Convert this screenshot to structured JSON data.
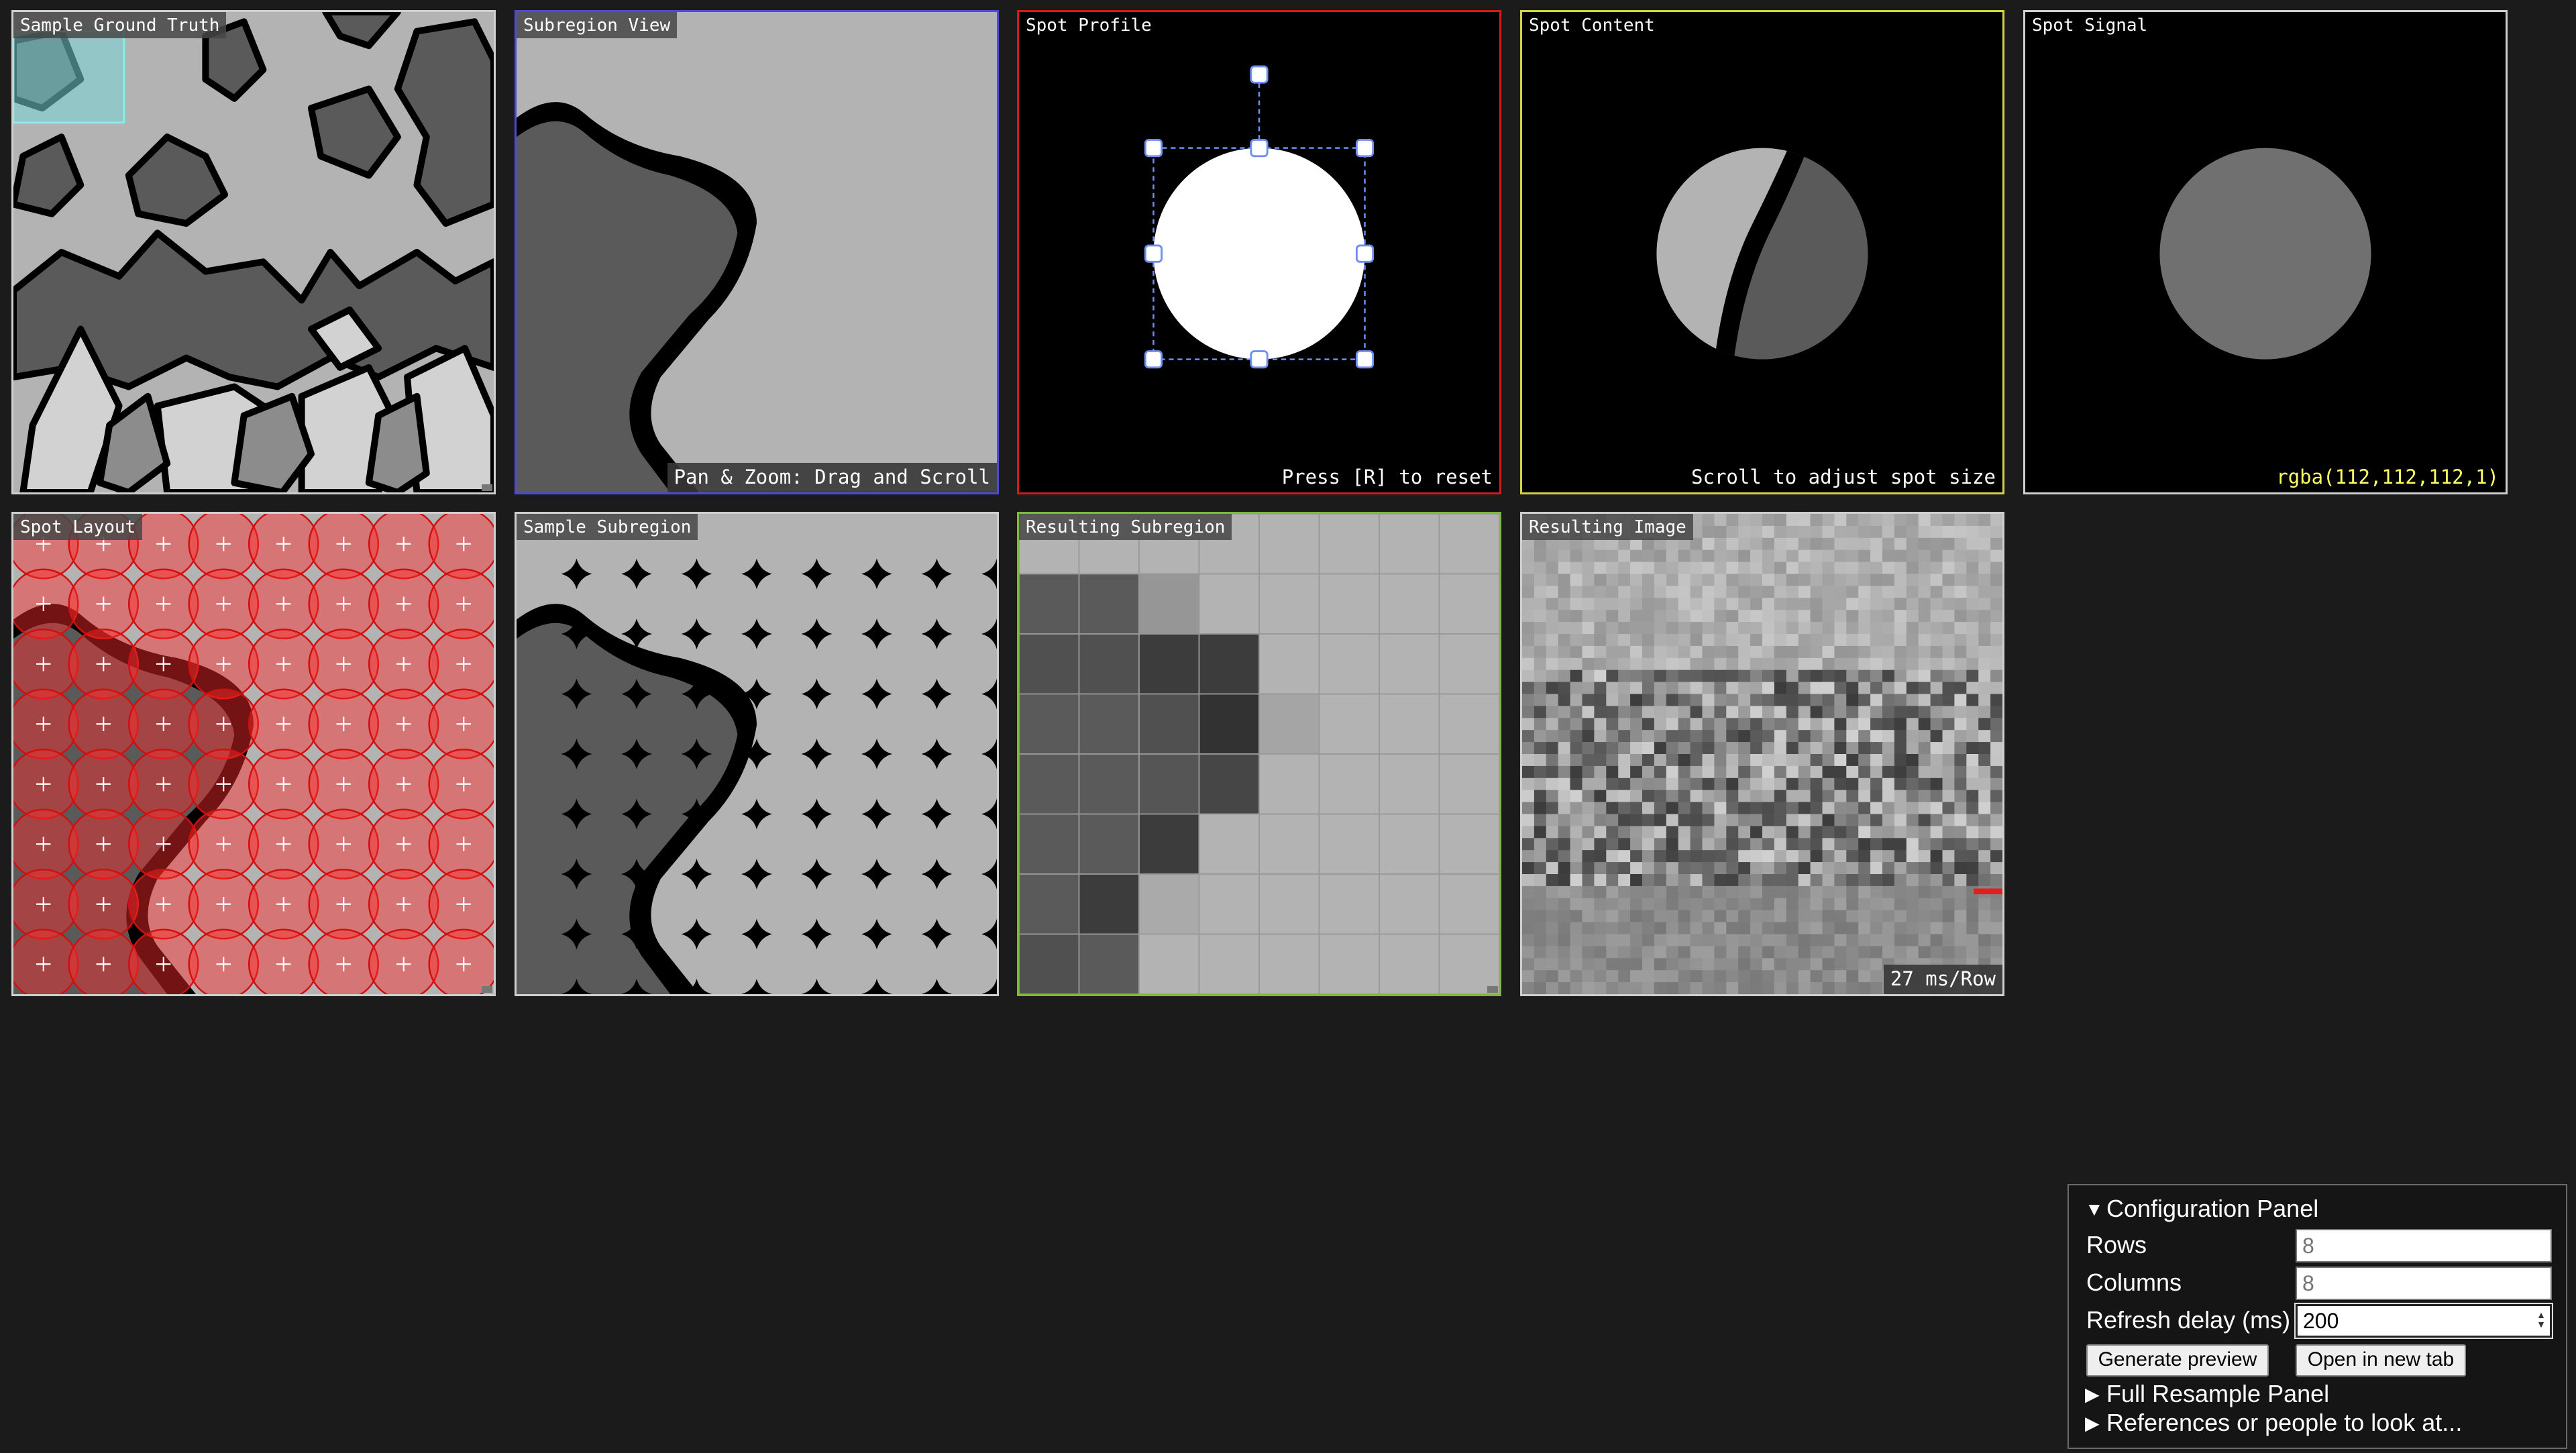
{
  "panels": {
    "ground_truth": {
      "title": "Sample Ground Truth"
    },
    "subregion_view": {
      "title": "Subregion View",
      "hint": "Pan & Zoom: Drag and Scroll"
    },
    "spot_profile": {
      "title": "Spot Profile",
      "hint": "Press [R] to reset"
    },
    "spot_content": {
      "title": "Spot Content",
      "hint": "Scroll to adjust spot size"
    },
    "spot_signal": {
      "title": "Spot Signal",
      "value": "rgba(112,112,112,1)"
    },
    "spot_layout": {
      "title": "Spot Layout"
    },
    "sample_subregion": {
      "title": "Sample Subregion"
    },
    "resulting_subregion": {
      "title": "Resulting Subregion"
    },
    "resulting_image": {
      "title": "Resulting Image",
      "timing": "27 ms/Row"
    }
  },
  "config": {
    "title": "Configuration Panel",
    "rows": {
      "label": "Rows",
      "placeholder": "8"
    },
    "columns": {
      "label": "Columns",
      "placeholder": "8"
    },
    "refresh": {
      "label": "Refresh delay (ms)",
      "value": "200"
    },
    "generate_label": "Generate preview",
    "open_tab_label": "Open in new tab",
    "full_resample_label": "Full Resample Panel",
    "references_label": "References or people to look at..."
  },
  "colors": {
    "background": "#1b1b1b",
    "spot_layout_circle": "#ff2a2a",
    "signal_text": "#ffff66",
    "signal_gray": "#707070"
  }
}
